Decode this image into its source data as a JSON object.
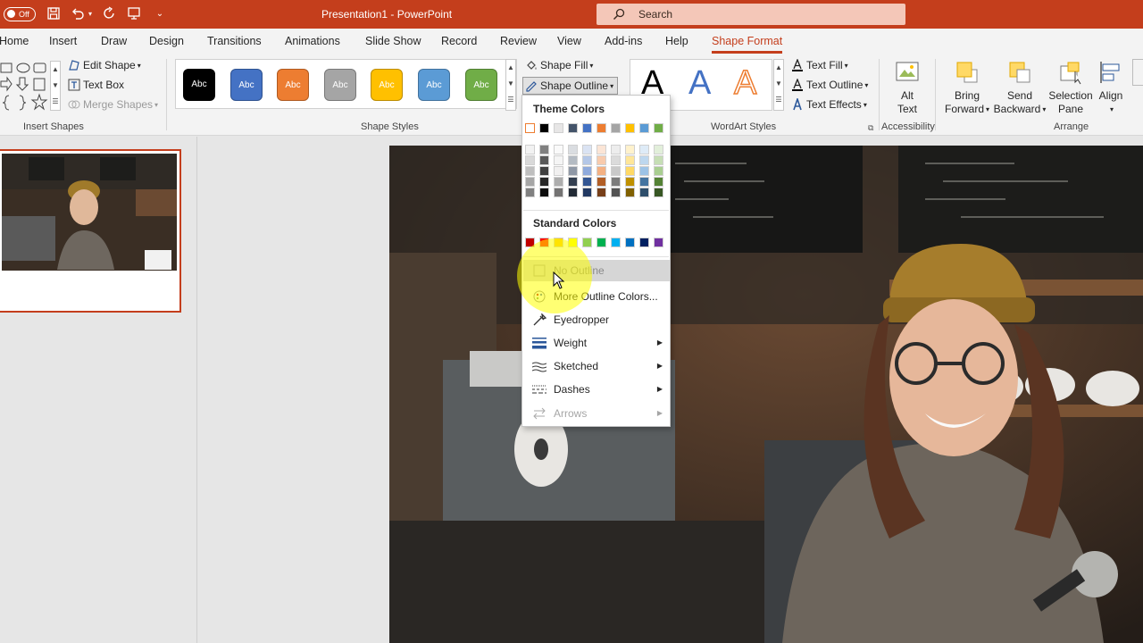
{
  "titlebar": {
    "autosave_label": "Off",
    "document_title": "Presentation1 - PowerPoint",
    "search_placeholder": "Search",
    "color": "#c43e1c"
  },
  "tabs": [
    {
      "label": "Home"
    },
    {
      "label": "Insert"
    },
    {
      "label": "Draw"
    },
    {
      "label": "Design"
    },
    {
      "label": "Transitions"
    },
    {
      "label": "Animations"
    },
    {
      "label": "Slide Show"
    },
    {
      "label": "Record"
    },
    {
      "label": "Review"
    },
    {
      "label": "View"
    },
    {
      "label": "Add-ins"
    },
    {
      "label": "Help"
    },
    {
      "label": "Shape Format",
      "active": true
    }
  ],
  "ribbon": {
    "insert_shapes": {
      "label": "Insert Shapes",
      "edit_shape": "Edit Shape",
      "text_box": "Text Box",
      "merge_shapes": "Merge Shapes"
    },
    "shape_styles": {
      "label": "Shape Styles",
      "preview_text": "Abc",
      "swatches": [
        "#000000",
        "#4472c4",
        "#ed7d31",
        "#a5a5a5",
        "#ffc000",
        "#5b9bd5",
        "#70ad47"
      ],
      "shape_fill": "Shape Fill",
      "shape_outline": "Shape Outline"
    },
    "wordart_styles": {
      "label": "WordArt Styles",
      "letter": "A",
      "text_fill": "Text Fill",
      "text_outline": "Text Outline",
      "text_effects": "Text Effects"
    },
    "accessibility": {
      "label": "Accessibility",
      "alt_text_line1": "Alt",
      "alt_text_line2": "Text"
    },
    "arrange": {
      "label": "Arrange",
      "bring_forward_line1": "Bring",
      "bring_forward_line2": "Forward",
      "send_backward_line1": "Send",
      "send_backward_line2": "Backward",
      "selection_pane_line1": "Selection",
      "selection_pane_line2": "Pane",
      "align": "Align"
    }
  },
  "outline_menu": {
    "theme_colors_heading": "Theme Colors",
    "theme_top_row": [
      "#ffffff",
      "#000000",
      "#e7e6e6",
      "#44546a",
      "#4472c4",
      "#ed7d31",
      "#a5a5a5",
      "#ffc000",
      "#5b9bd5",
      "#70ad47"
    ],
    "standard_colors_heading": "Standard Colors",
    "standard_colors": [
      "#c00000",
      "#ff0000",
      "#ffc000",
      "#ffff00",
      "#92d050",
      "#00b050",
      "#00b0f0",
      "#0070c0",
      "#002060",
      "#7030a0"
    ],
    "no_outline": "No Outline",
    "more_outline_colors": "More Outline Colors...",
    "eyedropper": "Eyedropper",
    "weight": "Weight",
    "sketched": "Sketched",
    "dashes": "Dashes",
    "arrows": "Arrows"
  }
}
